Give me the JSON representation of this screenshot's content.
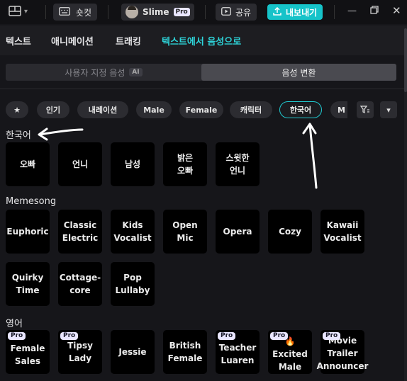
{
  "topbar": {
    "shortcut_label": "숏컷",
    "project_name": "Slime",
    "pro_badge": "Pro",
    "share_label": "공유",
    "export_label": "내보내기"
  },
  "tabs": [
    "텍스트",
    "애니메이션",
    "트래킹",
    "텍스트에서 음성으로"
  ],
  "segment": {
    "left_label": "사용자 지정 음성",
    "ai_badge": "AI",
    "right_label": "음성 변환"
  },
  "filters": [
    "인기",
    "내레이션",
    "Male",
    "Female",
    "캐릭터",
    "한국어",
    "M"
  ],
  "sections": {
    "korean": {
      "title": "한국어",
      "voices": [
        "오빠",
        "언니",
        "남성",
        "밝은\n오빠",
        "스윗한\n언니"
      ]
    },
    "memesong": {
      "title": "Memesong",
      "voices": [
        "Euphoric",
        "Classic\nElectric",
        "Kids\nVocalist",
        "Open Mic",
        "Opera",
        "Cozy",
        "Kawaii\nVocalist",
        "Quirky\nTime",
        "Cottage-\ncore",
        "Pop\nLullaby"
      ]
    },
    "english": {
      "title": "영어",
      "voices": [
        "Female\nSales",
        "Tipsy Lady",
        "Jessie",
        "British\nFemale",
        "Teacher\nLuaren",
        "🔥Excited\nMale",
        "Movie\nTrailer\nAnnouncer"
      ],
      "pro_badge": "Pro"
    }
  },
  "colors": {
    "accent": "#16c3c9",
    "active_tab": "#2ed4d9"
  }
}
